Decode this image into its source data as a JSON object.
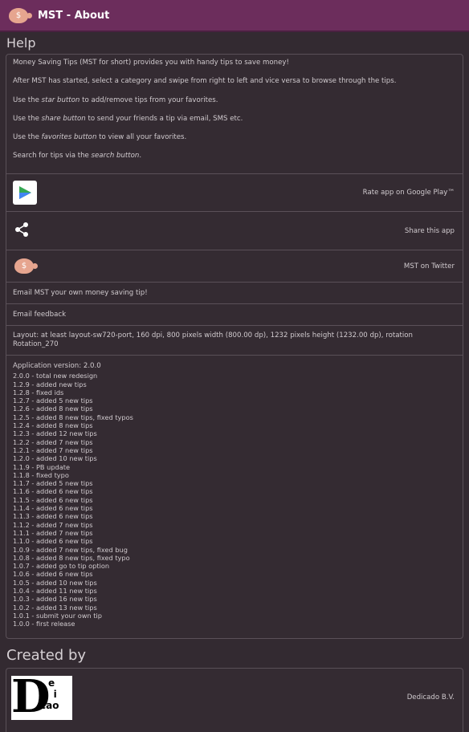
{
  "actionbar": {
    "title": "MST - About",
    "icon": "piggy-bank-icon"
  },
  "help": {
    "heading": "Help",
    "p1": "Money Saving Tips (MST for short) provides you with handy tips to save money!",
    "p2": "After MST has started, select a category and swipe from right to left and vice versa to browse through the tips.",
    "p3_pre": "Use the ",
    "p3_em": "star button",
    "p3_post": " to add/remove tips from your favorites.",
    "p4_pre": "Use the ",
    "p4_em": "share button",
    "p4_post": " to send your friends a tip via email, SMS etc.",
    "p5_pre": "Use the ",
    "p5_em": "favorites button",
    "p5_post": " to view all your favorites.",
    "p6_pre": "Search for tips via the ",
    "p6_em": "search button",
    "p6_post": "."
  },
  "rows": {
    "rate": "Rate app on Google Play™",
    "share": "Share this app",
    "twitter": "MST on Twitter",
    "email_tip": "Email MST your own money saving tip!",
    "email_feedback": "Email feedback",
    "layout": "Layout: at least layout-sw720-port, 160 dpi, 800 pixels width (800.00 dp), 1232 pixels height (1232.00 dp), rotation Rotation_270"
  },
  "changelog": {
    "version_label": "Application version: 2.0.0",
    "entries": [
      "2.0.0 - total new redesign",
      "1.2.9 - added new tips",
      "1.2.8 - fixed ids",
      "1.2.7 - added 5 new tips",
      "1.2.6 - added 8 new tips",
      "1.2.5 - added 8 new tips, fixed typos",
      "1.2.4 - added 8 new tips",
      "1.2.3 - added 12 new tips",
      "1.2.2 - added 7 new tips",
      "1.2.1 - added 7 new tips",
      "1.2.0 - added 10 new tips",
      "1.1.9 - PB update",
      "1.1.8 - fixed typo",
      "1.1.7 - added 5 new tips",
      "1.1.6 - added 6 new tips",
      "1.1.5 - added 6 new tips",
      "1.1.4 - added 6 new tips",
      "1.1.3 - added 6 new tips",
      "1.1.2 - added 7 new tips",
      "1.1.1 - added 7 new tips",
      "1.1.0 - added 6 new tips",
      "1.0.9 - added 7 new tips, fixed bug",
      "1.0.8 - added 8 new tips, fixed typo",
      "1.0.7 - added go to tip option",
      "1.0.6 - added 6 new tips",
      "1.0.5 - added 10 new tips",
      "1.0.4 - added 11 new tips",
      "1.0.3 - added 16 new tips",
      "1.0.2 - added 13 new tips",
      "1.0.1 - submit your own tip",
      "1.0.0 - first release"
    ]
  },
  "created": {
    "heading": "Created by",
    "company": "Dedicado B.V.",
    "logo_big": "D",
    "logo_letters": [
      "e",
      "d",
      "i",
      "c",
      "a",
      "o"
    ]
  },
  "colors": {
    "actionbar": "#6c2d5c",
    "background": "#332a31",
    "divider": "#5a5058"
  }
}
